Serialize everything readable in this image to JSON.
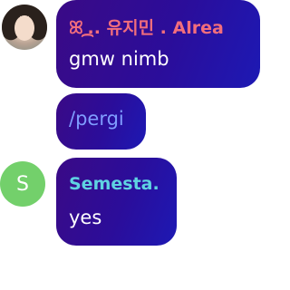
{
  "messages": [
    {
      "sender": "ꕤ ᷼.. 유지민 . Alrea",
      "text": "gmw nimb",
      "avatar": {
        "type": "photo",
        "icon": "user-photo-icon"
      }
    },
    {
      "text": "/pergi"
    },
    {
      "sender": "Semesta.",
      "text": "yes",
      "avatar": {
        "type": "letter",
        "letter": "S",
        "color": "#73d06b"
      }
    }
  ],
  "colors": {
    "bubble_start": "#3a0a86",
    "bubble_end": "#1d19b4",
    "sender1": "#f26e7c",
    "sender2": "#5fd3e2",
    "command_text": "#7f9dff"
  }
}
